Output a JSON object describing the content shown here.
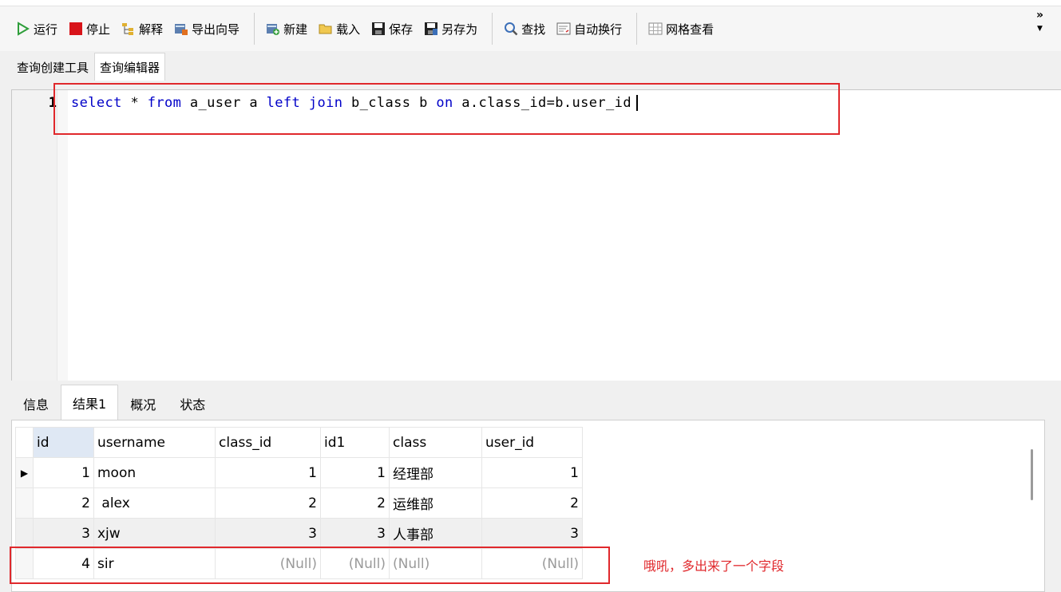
{
  "toolbar": {
    "run": "运行",
    "stop": "停止",
    "explain": "解释",
    "export_wizard": "导出向导",
    "new": "新建",
    "load": "载入",
    "save": "保存",
    "save_as": "另存为",
    "find": "查找",
    "word_wrap": "自动换行",
    "grid_view": "网格查看",
    "overflow": "»"
  },
  "editor_tabs": [
    "查询创建工具",
    "查询编辑器"
  ],
  "editor": {
    "line_number": "1",
    "tokens": [
      {
        "t": "select",
        "kw": true
      },
      {
        "t": " * ",
        "kw": false
      },
      {
        "t": "from",
        "kw": true
      },
      {
        "t": " a_user a ",
        "kw": false
      },
      {
        "t": "left",
        "kw": true
      },
      {
        "t": " ",
        "kw": false
      },
      {
        "t": "join",
        "kw": true
      },
      {
        "t": " b_class b ",
        "kw": false
      },
      {
        "t": "on",
        "kw": true
      },
      {
        "t": " a.class_id=b.user_id",
        "kw": false
      }
    ]
  },
  "result_tabs": [
    "信息",
    "结果1",
    "概况",
    "状态"
  ],
  "grid": {
    "columns": [
      "id",
      "username",
      "class_id",
      "id1",
      "class",
      "user_id"
    ],
    "rows": [
      [
        "1",
        "moon",
        "1",
        "1",
        "经理部",
        "1"
      ],
      [
        "2",
        " alex",
        "2",
        "2",
        "运维部",
        "2"
      ],
      [
        "3",
        "xjw",
        "3",
        "3",
        "人事部",
        "3"
      ],
      [
        "4",
        "sir",
        "(Null)",
        "(Null)",
        "(Null)",
        "(Null)"
      ]
    ]
  },
  "annotation": "哦吼，多出来了一个字段",
  "colors": {
    "keyword": "#0000c8",
    "highlight_red": "#e0282c"
  }
}
